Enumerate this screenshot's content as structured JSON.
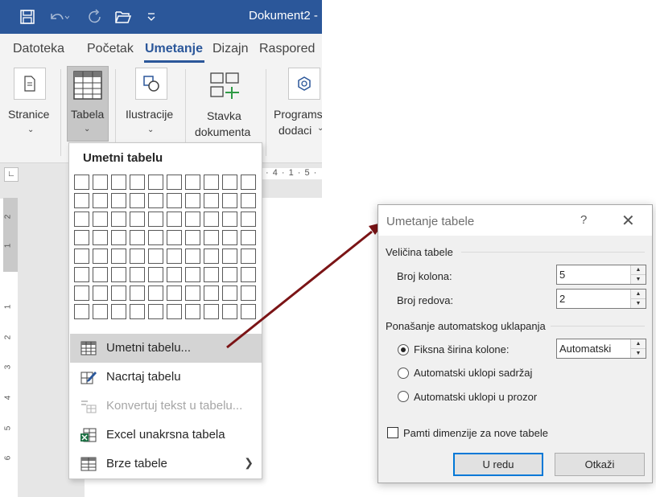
{
  "word": {
    "doc_title": "Dokument2  -",
    "tabs": [
      {
        "label": "Datoteka"
      },
      {
        "label": "Početak"
      },
      {
        "label": "Umetanje"
      },
      {
        "label": "Dizajn"
      },
      {
        "label": "Raspored"
      }
    ],
    "ribbon": {
      "stranice": "Stranice",
      "tabela": "Tabela",
      "ilustracije": "Ilustracije",
      "stavka_line1": "Stavka",
      "stavka_line2": "dokumenta",
      "programski_line1": "Programs",
      "programski_line2": "dodaci"
    },
    "h_ruler_text": "· 4 · 1 · 5 ·",
    "v_ruler_numbers": [
      "2",
      "1",
      "1",
      "2",
      "3",
      "4",
      "5",
      "6"
    ]
  },
  "dropdown": {
    "title": "Umetni tabelu",
    "grid": {
      "columns": 10,
      "rows": 8
    },
    "items": [
      {
        "label": "Umetni tabelu...",
        "icon": "table-icon",
        "hover": true,
        "disabled": false
      },
      {
        "label": "Nacrtaj tabelu",
        "icon": "pencil-table-icon",
        "hover": false,
        "disabled": false
      },
      {
        "label": "Konvertuj tekst u tabelu...",
        "icon": "convert-text-icon",
        "hover": false,
        "disabled": true
      },
      {
        "label": "Excel unakrsna tabela",
        "icon": "excel-icon",
        "hover": false,
        "disabled": false
      },
      {
        "label": "Brze tabele",
        "icon": "quick-tables-icon",
        "hover": false,
        "disabled": false,
        "submenu": true
      }
    ]
  },
  "dialog": {
    "title": "Umetanje tabele",
    "help": "?",
    "size_group": "Veličina tabele",
    "columns_label": "Broj kolona:",
    "columns_value": "5",
    "rows_label": "Broj redova:",
    "rows_value": "2",
    "autofit_group": "Ponašanje automatskog uklapanja",
    "fixed_width_label": "Fiksna širina kolone:",
    "fixed_width_value": "Automatski",
    "autofit_contents_label": "Automatski uklopi sadržaj",
    "autofit_window_label": "Automatski uklopi u prozor",
    "remember_label": "Pamti dimenzije za nove tabele",
    "ok": "U redu",
    "cancel": "Otkaži"
  },
  "colors": {
    "word_blue": "#2b579a",
    "arrow": "#7b1416",
    "focus_blue": "#0078d7"
  }
}
